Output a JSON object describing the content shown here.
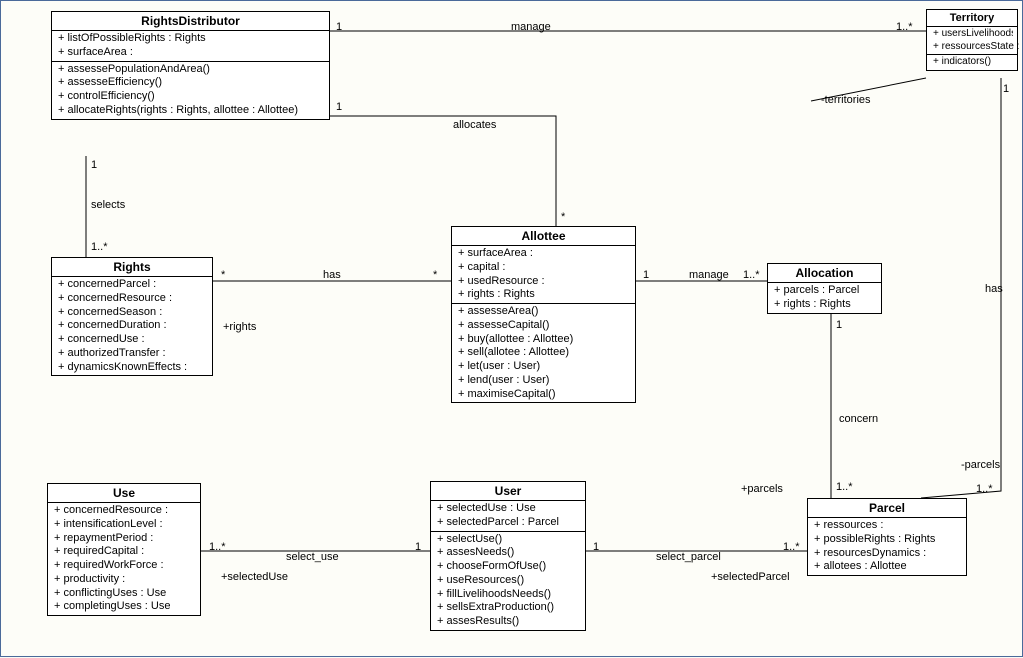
{
  "classes": {
    "RightsDistributor": {
      "title": "RightsDistributor",
      "attrs": [
        "+ listOfPossibleRights : Rights",
        "+ surfaceArea :"
      ],
      "ops": [
        "+ assessePopulationAndArea()",
        "+ assesseEfficiency()",
        "+ controlEfficiency()",
        "+ allocateRights(rights : Rights, allottee : Allottee)"
      ]
    },
    "Territory": {
      "title": "Territory",
      "attrs": [
        "+ usersLivelihoodsNeeds :",
        "+ ressourcesState :"
      ],
      "ops": [
        "+ indicators()"
      ]
    },
    "Rights": {
      "title": "Rights",
      "attrs": [
        "+ concernedParcel :",
        "+ concernedResource :",
        "+ concernedSeason :",
        "+ concernedDuration :",
        "+ concernedUse :",
        "+ authorizedTransfer :",
        "+ dynamicsKnownEffects :"
      ],
      "ops": []
    },
    "Allottee": {
      "title": "Allottee",
      "attrs": [
        "+ surfaceArea :",
        "+ capital :",
        "+ usedResource :",
        "+ rights : Rights"
      ],
      "ops": [
        "+ assesseArea()",
        "+ assesseCapital()",
        "+ buy(allottee : Allottee)",
        "+ sell(allotee : Allottee)",
        "+ let(user : User)",
        "+ lend(user : User)",
        "+ maximiseCapital()"
      ]
    },
    "Allocation": {
      "title": "Allocation",
      "attrs": [
        "+ parcels : Parcel",
        "+ rights : Rights"
      ],
      "ops": []
    },
    "Use": {
      "title": "Use",
      "attrs": [
        "+ concernedResource :",
        "+ intensificationLevel :",
        "+ repaymentPeriod :",
        "+ requiredCapital :",
        "+ requiredWorkForce :",
        "+ productivity :",
        "+ conflictingUses : Use",
        "+ completingUses : Use"
      ],
      "ops": []
    },
    "User": {
      "title": "User",
      "attrs": [
        "+ selectedUse : Use",
        "+ selectedParcel : Parcel"
      ],
      "ops": [
        "+ selectUse()",
        "+ assesNeeds()",
        "+ chooseFormOfUse()",
        "+ useResources()",
        "+ fillLivelihoodsNeeds()",
        "+ sellsExtraProduction()",
        "+ assesResults()"
      ]
    },
    "Parcel": {
      "title": "Parcel",
      "attrs": [
        "+ ressources :",
        "+ possibleRights : Rights",
        "+ resourcesDynamics :",
        "+ allotees : Allottee"
      ],
      "ops": []
    }
  },
  "assoc": {
    "manage1": {
      "name": "manage",
      "left": "1",
      "right": "1..*"
    },
    "allocates": {
      "name": "allocates",
      "left": "1",
      "right": "*"
    },
    "territories": {
      "role": "-territories"
    },
    "selects": {
      "name": "selects",
      "top": "1",
      "bottom": "1..*"
    },
    "rightsRole": {
      "role": "+rights"
    },
    "has_rights_allottee": {
      "name": "has",
      "left": "*",
      "right": "*"
    },
    "manage2": {
      "name": "manage",
      "left": "1",
      "right": "1..*"
    },
    "concern": {
      "name": "concern",
      "top": "1",
      "bottom": "1..*"
    },
    "has_territory_parcel": {
      "name": "has",
      "top": "1",
      "bottomRole": "-parcels",
      "bottom": "1..*"
    },
    "select_use": {
      "name": "select_use",
      "left": "1..*",
      "right": "1",
      "roleLeft": "+selectedUse"
    },
    "select_parcel": {
      "name": "select_parcel",
      "left": "1",
      "right": "1..*",
      "roleRightTop": "+parcels",
      "roleRightBottom": "+selectedParcel"
    }
  }
}
